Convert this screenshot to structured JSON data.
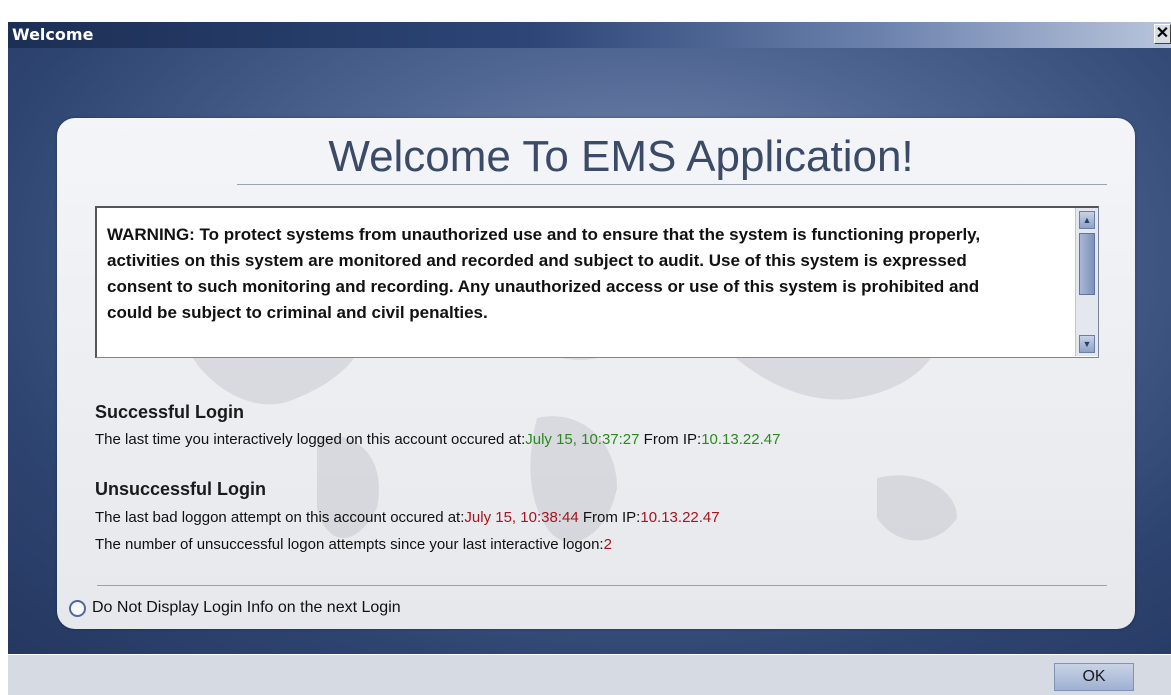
{
  "window": {
    "title": "Welcome",
    "close_glyph": "✕"
  },
  "panel": {
    "heading": "Welcome To EMS Application!",
    "warning": "WARNING: To protect systems from unauthorized use and to ensure that the system is functioning properly, activities on this system are monitored and recorded and subject to audit. Use of this system is expressed consent to such monitoring and recording. Any unauthorized access or use of this system is prohibited and could be subject to criminal and civil penalties."
  },
  "successful_login": {
    "title": "Successful Login",
    "text": "The last time you interactively logged on this account occured at:",
    "time": "July 15, 10:37:27",
    "from_label": "From IP:",
    "ip": "10.13.22.47"
  },
  "unsuccessful_login": {
    "title": "Unsuccessful Login",
    "text": "The last bad loggon attempt on this account occured at:",
    "time": "July 15, 10:38:44",
    "from_label": "From IP:",
    "ip": "10.13.22.47",
    "count_text": "The number of unsuccessful logon attempts since your last interactive logon:",
    "count": "2"
  },
  "option": {
    "label": "Do Not Display Login Info on the next Login"
  },
  "footer": {
    "ok_label": "OK"
  },
  "colors": {
    "success": "#2b8a1c",
    "failure": "#a3161e"
  }
}
